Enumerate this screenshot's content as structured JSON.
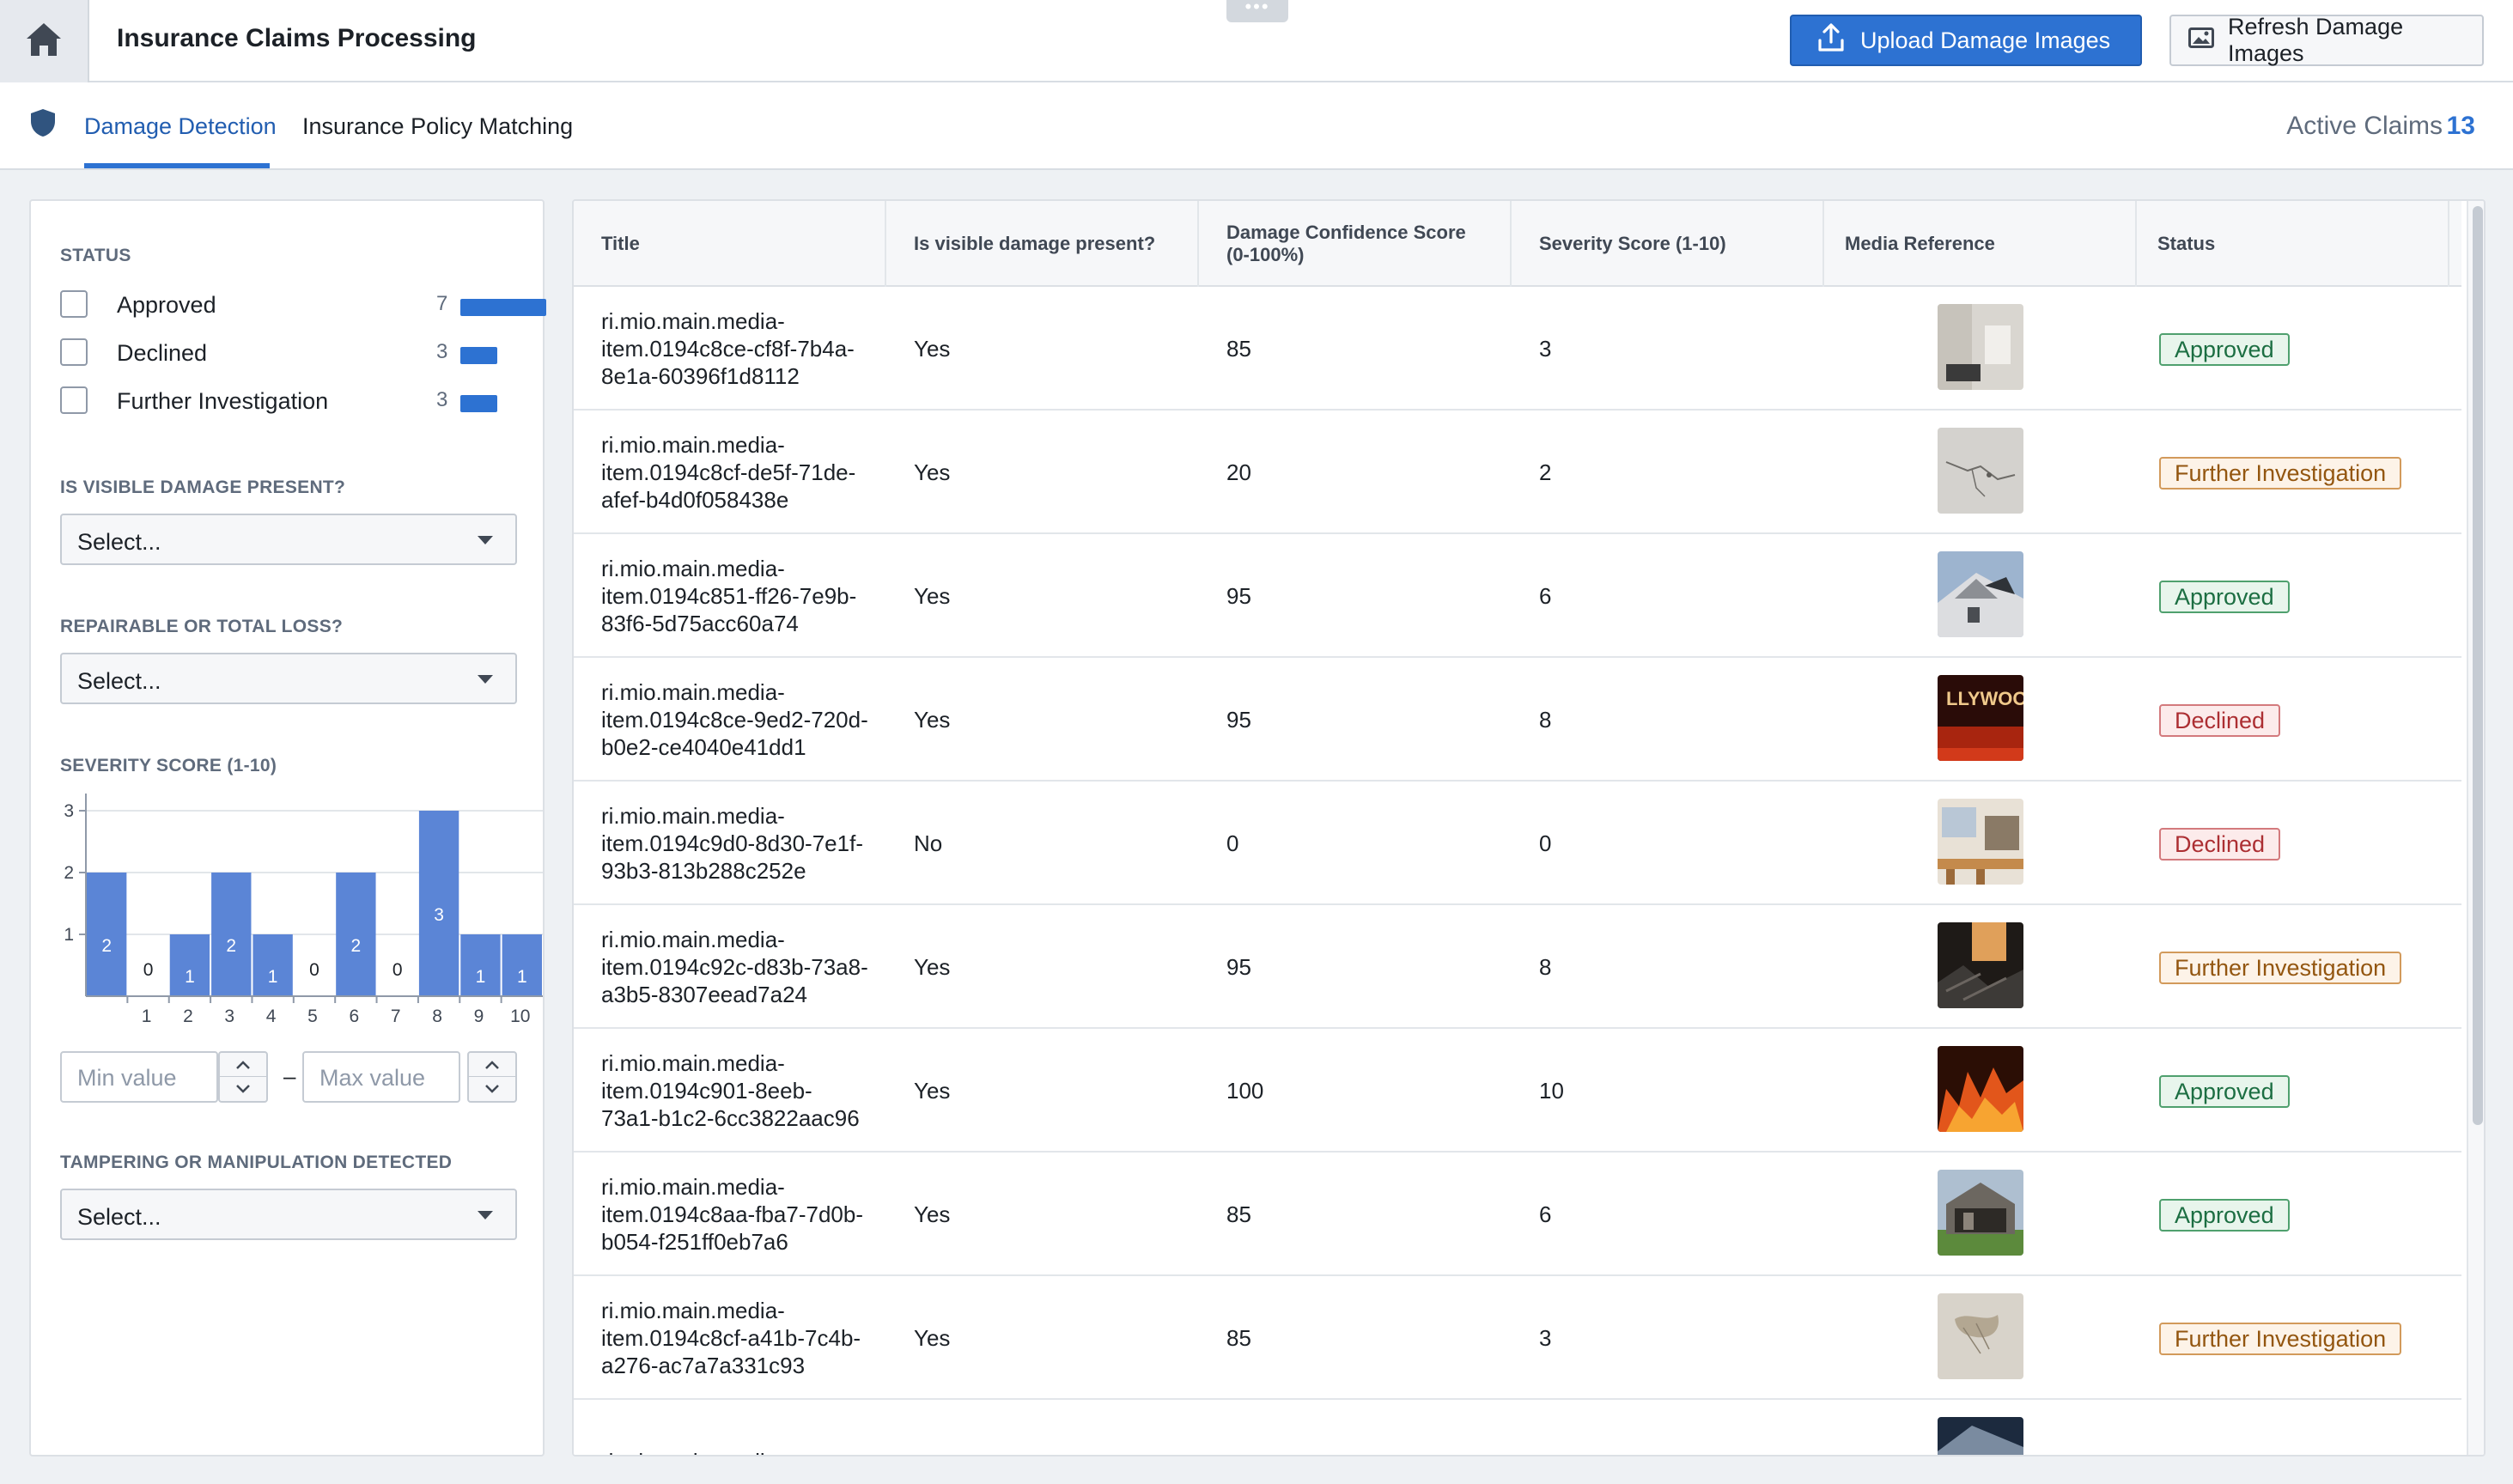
{
  "header": {
    "title": "Insurance Claims Processing",
    "drag_handle": "•••",
    "upload_label": "Upload Damage Images",
    "refresh_label": "Refresh Damage Images"
  },
  "tabs": {
    "damage_detection": "Damage Detection",
    "policy_matching": "Insurance Policy Matching",
    "active_claims_label": "Active Claims",
    "active_claims_count": "13"
  },
  "filters": {
    "status": {
      "title": "STATUS",
      "items": [
        {
          "label": "Approved",
          "count": "7",
          "fraction": 1.0
        },
        {
          "label": "Declined",
          "count": "3",
          "fraction": 0.43
        },
        {
          "label": "Further Investigation",
          "count": "3",
          "fraction": 0.43
        }
      ]
    },
    "visible_damage": {
      "title": "IS VISIBLE DAMAGE PRESENT?",
      "value": "Select..."
    },
    "repairable": {
      "title": "REPAIRABLE OR TOTAL LOSS?",
      "value": "Select..."
    },
    "severity": {
      "title": "SEVERITY SCORE (1-10)",
      "min_placeholder": "Min value",
      "max_placeholder": "Max value",
      "range_dash": "–"
    },
    "tampering": {
      "title": "TAMPERING OR MANIPULATION DETECTED",
      "value": "Select..."
    }
  },
  "chart_data": {
    "type": "bar",
    "title": "SEVERITY SCORE (1-10)",
    "bins": [
      {
        "tick": "",
        "value": 2
      },
      {
        "tick": "1",
        "value": 0
      },
      {
        "tick": "2",
        "value": 1
      },
      {
        "tick": "3",
        "value": 2
      },
      {
        "tick": "4",
        "value": 1
      },
      {
        "tick": "5",
        "value": 0
      },
      {
        "tick": "6",
        "value": 2
      },
      {
        "tick": "7",
        "value": 0
      },
      {
        "tick": "8",
        "value": 3
      },
      {
        "tick": "9",
        "value": 1
      },
      {
        "tick": "10",
        "value": 1
      }
    ],
    "y_ticks": [
      "1",
      "2",
      "3"
    ],
    "ylim": [
      0,
      3
    ],
    "bar_color": "#5b85d6",
    "grid": true
  },
  "table": {
    "columns": [
      "Title",
      "Is visible damage present?",
      "Damage Confidence Score (0-100%)",
      "Severity Score (1-10)",
      "Media Reference",
      "Status"
    ],
    "rows": [
      {
        "title": "ri.mio.main.media-item.0194c8ce-cf8f-7b4a-8e1a-60396f1d8112",
        "damage": "Yes",
        "confidence": "85",
        "severity": "3",
        "thumb": "white-interior-room",
        "status": "Approved",
        "status_kind": "approved"
      },
      {
        "title": "ri.mio.main.media-item.0194c8cf-de5f-71de-afef-b4d0f058438e",
        "damage": "Yes",
        "confidence": "20",
        "severity": "2",
        "thumb": "cracked-wall",
        "status": "Further Investigation",
        "status_kind": "investigation"
      },
      {
        "title": "ri.mio.main.media-item.0194c851-ff26-7e9b-83f6-5d75acc60a74",
        "damage": "Yes",
        "confidence": "95",
        "severity": "6",
        "thumb": "damaged-house-roof",
        "status": "Approved",
        "status_kind": "approved"
      },
      {
        "title": "ri.mio.main.media-item.0194c8ce-9ed2-720d-b0e2-ce4040e41dd1",
        "damage": "Yes",
        "confidence": "95",
        "severity": "8",
        "thumb": "fire-sign",
        "status": "Declined",
        "status_kind": "declined"
      },
      {
        "title": "ri.mio.main.media-item.0194c9d0-8d30-7e1f-93b3-813b288c252e",
        "damage": "No",
        "confidence": "0",
        "severity": "0",
        "thumb": "kitchen-interior",
        "status": "Declined",
        "status_kind": "declined"
      },
      {
        "title": "ri.mio.main.media-item.0194c92c-d83b-73a8-a3b5-8307eead7a24",
        "damage": "Yes",
        "confidence": "95",
        "severity": "8",
        "thumb": "burned-interior",
        "status": "Further Investigation",
        "status_kind": "investigation"
      },
      {
        "title": "ri.mio.main.media-item.0194c901-8eeb-73a1-b1c2-6cc3822aac96",
        "damage": "Yes",
        "confidence": "100",
        "severity": "10",
        "thumb": "house-fire",
        "status": "Approved",
        "status_kind": "approved"
      },
      {
        "title": "ri.mio.main.media-item.0194c8aa-fba7-7d0b-b054-f251ff0eb7a6",
        "damage": "Yes",
        "confidence": "85",
        "severity": "6",
        "thumb": "collapsed-house",
        "status": "Approved",
        "status_kind": "approved"
      },
      {
        "title": "ri.mio.main.media-item.0194c8cf-a41b-7c4b-a276-ac7a7a331c93",
        "damage": "Yes",
        "confidence": "85",
        "severity": "3",
        "thumb": "stained-ceiling",
        "status": "Further Investigation",
        "status_kind": "investigation"
      },
      {
        "title": "ri.mio.main.media-",
        "damage": "",
        "confidence": "",
        "severity": "",
        "thumb": "damaged-building",
        "status": "",
        "status_kind": "approved"
      }
    ]
  }
}
